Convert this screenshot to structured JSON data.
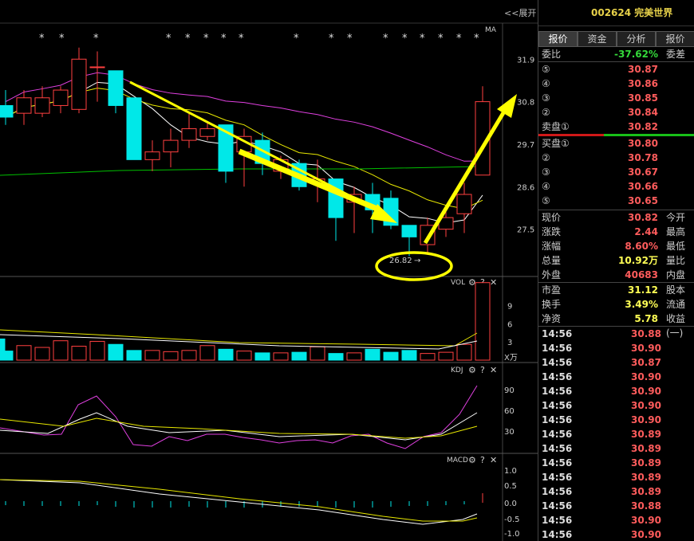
{
  "header": {
    "expand": "<<展开",
    "stock": "002624 完美世界",
    "ma_label": "MA"
  },
  "tabs": [
    "报价",
    "资金",
    "分析",
    "报价"
  ],
  "weibi": {
    "label": "委比",
    "value": "-37.62%",
    "label2": "委差"
  },
  "asks": [
    {
      "label": "⑤",
      "price": "30.87"
    },
    {
      "label": "④",
      "price": "30.86"
    },
    {
      "label": "③",
      "price": "30.85"
    },
    {
      "label": "②",
      "price": "30.84"
    },
    {
      "label": "卖盘①",
      "price": "30.82"
    }
  ],
  "bids": [
    {
      "label": "买盘①",
      "price": "30.80"
    },
    {
      "label": "②",
      "price": "30.78"
    },
    {
      "label": "③",
      "price": "30.67"
    },
    {
      "label": "④",
      "price": "30.66"
    },
    {
      "label": "⑤",
      "price": "30.65"
    }
  ],
  "stats1": [
    {
      "l": "现价",
      "v": "30.82",
      "r": "今开",
      "color": "red"
    },
    {
      "l": "涨跌",
      "v": "2.44",
      "r": "最高",
      "color": "red"
    },
    {
      "l": "涨幅",
      "v": "8.60%",
      "r": "最低",
      "color": "red"
    },
    {
      "l": "总量",
      "v": "10.92",
      "unit": "万",
      "r": "量比",
      "color": "yellow"
    },
    {
      "l": "外盘",
      "v": "40683",
      "r": "内盘",
      "color": "red"
    }
  ],
  "stats2": [
    {
      "l": "市盈",
      "v": "31.12",
      "r": "股本"
    },
    {
      "l": "换手",
      "v": "3.49%",
      "r": "流通"
    },
    {
      "l": "净资",
      "v": "5.78",
      "r": "收益(一)"
    }
  ],
  "ticks": [
    {
      "t": "14:56",
      "p": "30.88"
    },
    {
      "t": "14:56",
      "p": "30.90"
    },
    {
      "t": "14:56",
      "p": "30.87"
    },
    {
      "t": "14:56",
      "p": "30.90"
    },
    {
      "t": "14:56",
      "p": "30.90"
    },
    {
      "t": "14:56",
      "p": "30.90"
    },
    {
      "t": "14:56",
      "p": "30.90"
    },
    {
      "t": "14:56",
      "p": "30.89"
    },
    {
      "t": "14:56",
      "p": "30.89"
    },
    {
      "t": "14:56",
      "p": "30.89"
    },
    {
      "t": "14:56",
      "p": "30.89"
    },
    {
      "t": "14:56",
      "p": "30.89"
    },
    {
      "t": "14:56",
      "p": "30.88"
    },
    {
      "t": "14:56",
      "p": "30.90"
    },
    {
      "t": "14:56",
      "p": "30.90"
    }
  ],
  "panels": {
    "vol": {
      "label": "VOL",
      "unit": "X万",
      "yticks": [
        "9",
        "6",
        "3"
      ]
    },
    "kdj": {
      "label": "KDJ",
      "yticks": [
        "90",
        "60",
        "30"
      ]
    },
    "macd": {
      "label": "MACD",
      "yticks": [
        "1.0",
        "0.5",
        "0.0",
        "-0.5",
        "-1.0"
      ]
    }
  },
  "annotation_low": "26.82",
  "colors": {
    "up": "#ff4040",
    "down": "#00e8e8",
    "ma5": "#ffffff",
    "ma10": "#e8e800",
    "ma20": "#e040e0",
    "ma60": "#00c000",
    "arrow": "#ffff00"
  },
  "chart_data": {
    "type": "candlestick",
    "ylim": [
      26.4,
      32.4
    ],
    "yticks": [
      31.9,
      30.8,
      29.7,
      28.6,
      27.5
    ],
    "candles": [
      {
        "o": 30.7,
        "c": 30.4,
        "h": 31.1,
        "l": 30.2
      },
      {
        "o": 30.5,
        "c": 30.9,
        "h": 31.1,
        "l": 30.2
      },
      {
        "o": 30.5,
        "c": 30.9,
        "h": 31.2,
        "l": 30.4
      },
      {
        "o": 30.7,
        "c": 31.1,
        "h": 31.2,
        "l": 30.5
      },
      {
        "o": 30.6,
        "c": 31.9,
        "h": 32.2,
        "l": 30.5
      },
      {
        "o": 31.7,
        "c": 31.7,
        "h": 32.1,
        "l": 30.8
      },
      {
        "o": 31.6,
        "c": 30.7,
        "h": 31.6,
        "l": 30.5
      },
      {
        "o": 30.9,
        "c": 29.3,
        "h": 30.9,
        "l": 29.3
      },
      {
        "o": 29.3,
        "c": 29.5,
        "h": 29.8,
        "l": 29.0
      },
      {
        "o": 29.5,
        "c": 29.8,
        "h": 30.1,
        "l": 29.1
      },
      {
        "o": 29.8,
        "c": 30.1,
        "h": 30.5,
        "l": 29.6
      },
      {
        "o": 29.9,
        "c": 30.1,
        "h": 30.3,
        "l": 29.8
      },
      {
        "o": 30.2,
        "c": 29.0,
        "h": 30.2,
        "l": 28.7
      },
      {
        "o": 29.5,
        "c": 29.9,
        "h": 30.1,
        "l": 28.6
      },
      {
        "o": 29.8,
        "c": 29.2,
        "h": 30.0,
        "l": 28.9
      },
      {
        "o": 29.0,
        "c": 29.3,
        "h": 29.4,
        "l": 28.8
      },
      {
        "o": 29.2,
        "c": 28.6,
        "h": 29.3,
        "l": 28.5
      },
      {
        "o": 28.7,
        "c": 28.8,
        "h": 29.3,
        "l": 28.2
      },
      {
        "o": 28.8,
        "c": 27.8,
        "h": 28.8,
        "l": 27.2
      },
      {
        "o": 28.2,
        "c": 28.4,
        "h": 28.6,
        "l": 27.4
      },
      {
        "o": 28.4,
        "c": 28.0,
        "h": 28.7,
        "l": 27.4
      },
      {
        "o": 28.3,
        "c": 27.6,
        "h": 28.5,
        "l": 27.5
      },
      {
        "o": 27.6,
        "c": 27.3,
        "h": 27.6,
        "l": 26.8
      },
      {
        "o": 27.1,
        "c": 27.6,
        "h": 27.8,
        "l": 26.9
      },
      {
        "o": 27.5,
        "c": 27.8,
        "h": 28.0,
        "l": 27.3
      },
      {
        "o": 27.9,
        "c": 28.4,
        "h": 28.7,
        "l": 27.4
      },
      {
        "o": 28.9,
        "c": 30.8,
        "h": 31.2,
        "l": 28.9
      }
    ],
    "volume": [
      3.5,
      1.5,
      2.4,
      2.1,
      3.2,
      2.3,
      3.1,
      2.6,
      1.6,
      1.6,
      1.4,
      1.6,
      2.4,
      1.8,
      1.5,
      1.2,
      1.2,
      1.3,
      2.2,
      1.1,
      1.2,
      1.8,
      1.3,
      1.6,
      1.1,
      1.3,
      2.6,
      12.8
    ]
  }
}
